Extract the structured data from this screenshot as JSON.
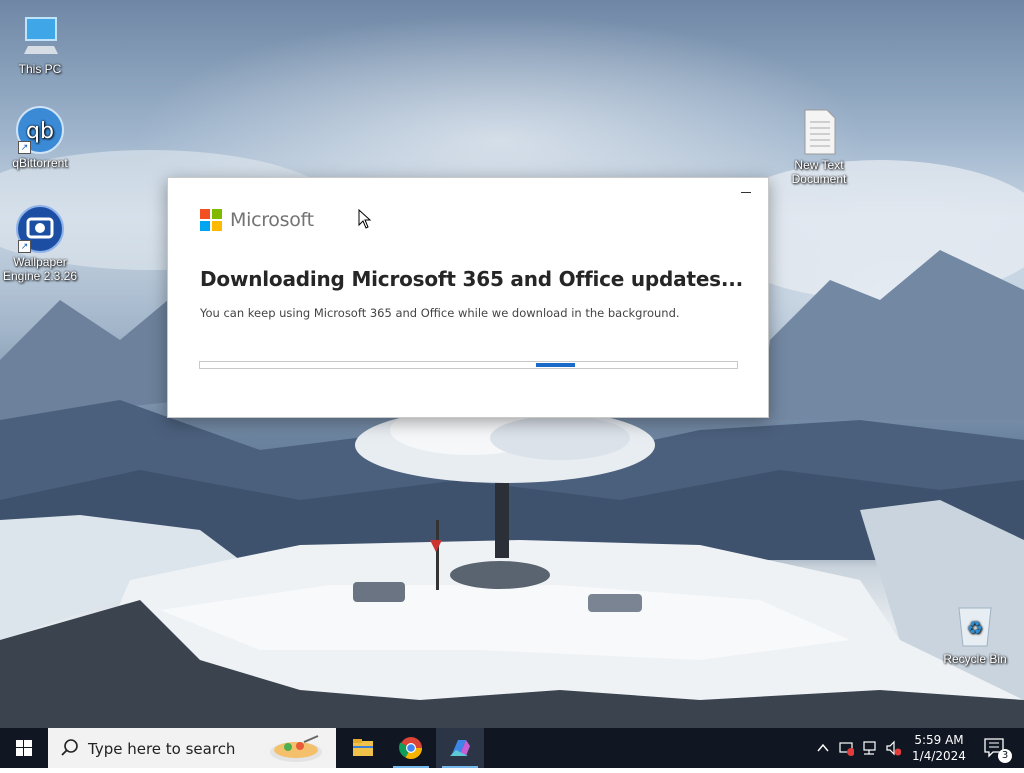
{
  "desktop": {
    "icons": [
      {
        "label": "This PC",
        "icon": "this-pc-icon"
      },
      {
        "label": "qBittorrent",
        "icon": "qbittorrent-icon"
      },
      {
        "label": "Wallpaper Engine 2.3.26",
        "icon": "wallpaper-engine-icon"
      },
      {
        "label": "New Text Document",
        "icon": "text-document-icon"
      },
      {
        "label": "Recycle Bin",
        "icon": "recycle-bin-icon"
      }
    ]
  },
  "dialog": {
    "brand": "Microsoft",
    "title": "Downloading Microsoft 365 and Office updates...",
    "subtitle": "You can keep using Microsoft 365 and Office while we download in the background.",
    "minimize_icon": "minimize-icon",
    "progress": {
      "mode": "indeterminate",
      "color": "#1b6ac9"
    },
    "logo_colors": [
      "#f25022",
      "#7fba00",
      "#00a4ef",
      "#ffb900"
    ]
  },
  "taskbar": {
    "search_placeholder": "Type here to search",
    "apps": [
      "file-explorer-icon",
      "chrome-icon",
      "copilot-icon"
    ],
    "tray": [
      "chevron-up-icon",
      "network-blocked-icon",
      "network-icon",
      "volume-muted-icon"
    ],
    "time": "5:59 AM",
    "date": "1/4/2024",
    "notification_count": "3",
    "background": "#101723"
  }
}
